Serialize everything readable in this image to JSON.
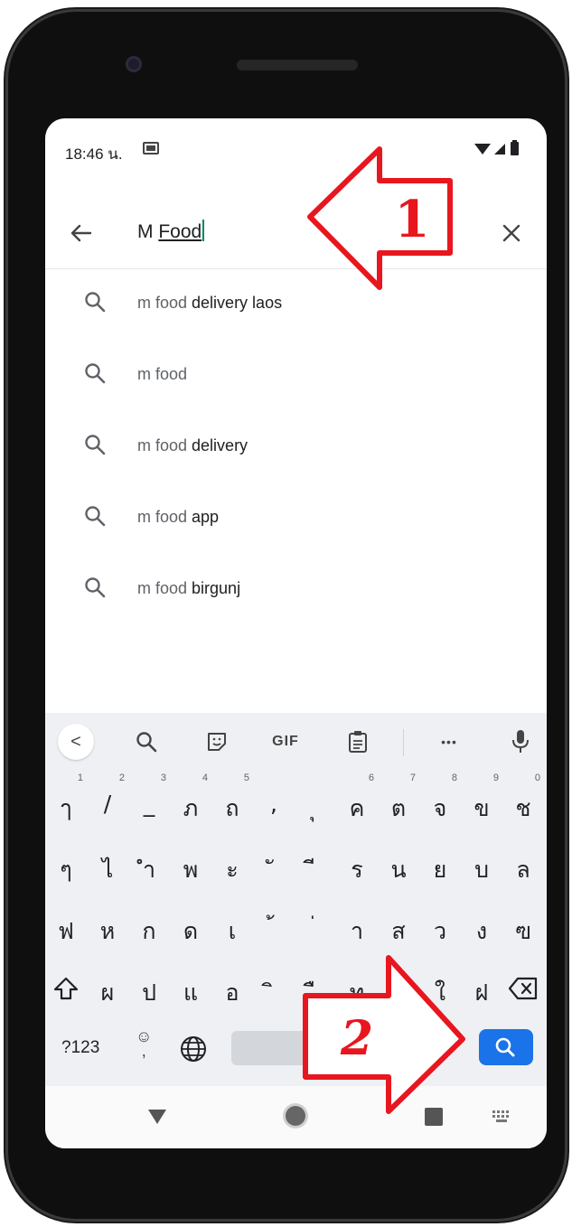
{
  "status_bar": {
    "time": "18:46 น."
  },
  "search": {
    "prefix": "M ",
    "underlined": "Food"
  },
  "suggestions": [
    {
      "prefix": "m food",
      "rest": " delivery laos"
    },
    {
      "prefix": "m food",
      "rest": ""
    },
    {
      "prefix": "m food",
      "rest": " delivery"
    },
    {
      "prefix": "m food",
      "rest": " app"
    },
    {
      "prefix": "m food",
      "rest": " birgunj"
    }
  ],
  "keyboard": {
    "toolbar": {
      "back": "<",
      "gif": "GIF",
      "more": "•••"
    },
    "row1": [
      {
        "ch": "ๅ",
        "num": "1"
      },
      {
        "ch": "/",
        "num": "2"
      },
      {
        "ch": "_",
        "num": "3"
      },
      {
        "ch": "ภ",
        "num": "4"
      },
      {
        "ch": "ถ",
        "num": "5"
      },
      {
        "ch": ",",
        "num": ""
      },
      {
        "ch": "ุ",
        "num": ""
      },
      {
        "ch": "ค",
        "num": "6"
      },
      {
        "ch": "ต",
        "num": "7"
      },
      {
        "ch": "จ",
        "num": "8"
      },
      {
        "ch": "ข",
        "num": "9"
      },
      {
        "ch": "ช",
        "num": "0"
      }
    ],
    "row2": [
      "ๆ",
      "ไ",
      "ำ",
      "พ",
      "ะ",
      "ั",
      "ี",
      "ร",
      "น",
      "ย",
      "บ",
      "ล"
    ],
    "row3": [
      "ฟ",
      "ห",
      "ก",
      "ด",
      "เ",
      "้",
      "่",
      "า",
      "ส",
      "ว",
      "ง",
      "ฃ"
    ],
    "row4": [
      "ผ",
      "ป",
      "แ",
      "อ",
      "ิ",
      "ื",
      "ท",
      "ม",
      "ใ",
      "ฝ"
    ],
    "symbols_key": "?123",
    "emoji_comma": ",",
    "space_label": "ไทย",
    "period": "."
  },
  "annotations": {
    "arrow1_number": "1",
    "arrow2_number": "2",
    "arrow_color": "#e8161e"
  },
  "colors": {
    "accent": "#1a73e8",
    "caret": "#01875f"
  }
}
